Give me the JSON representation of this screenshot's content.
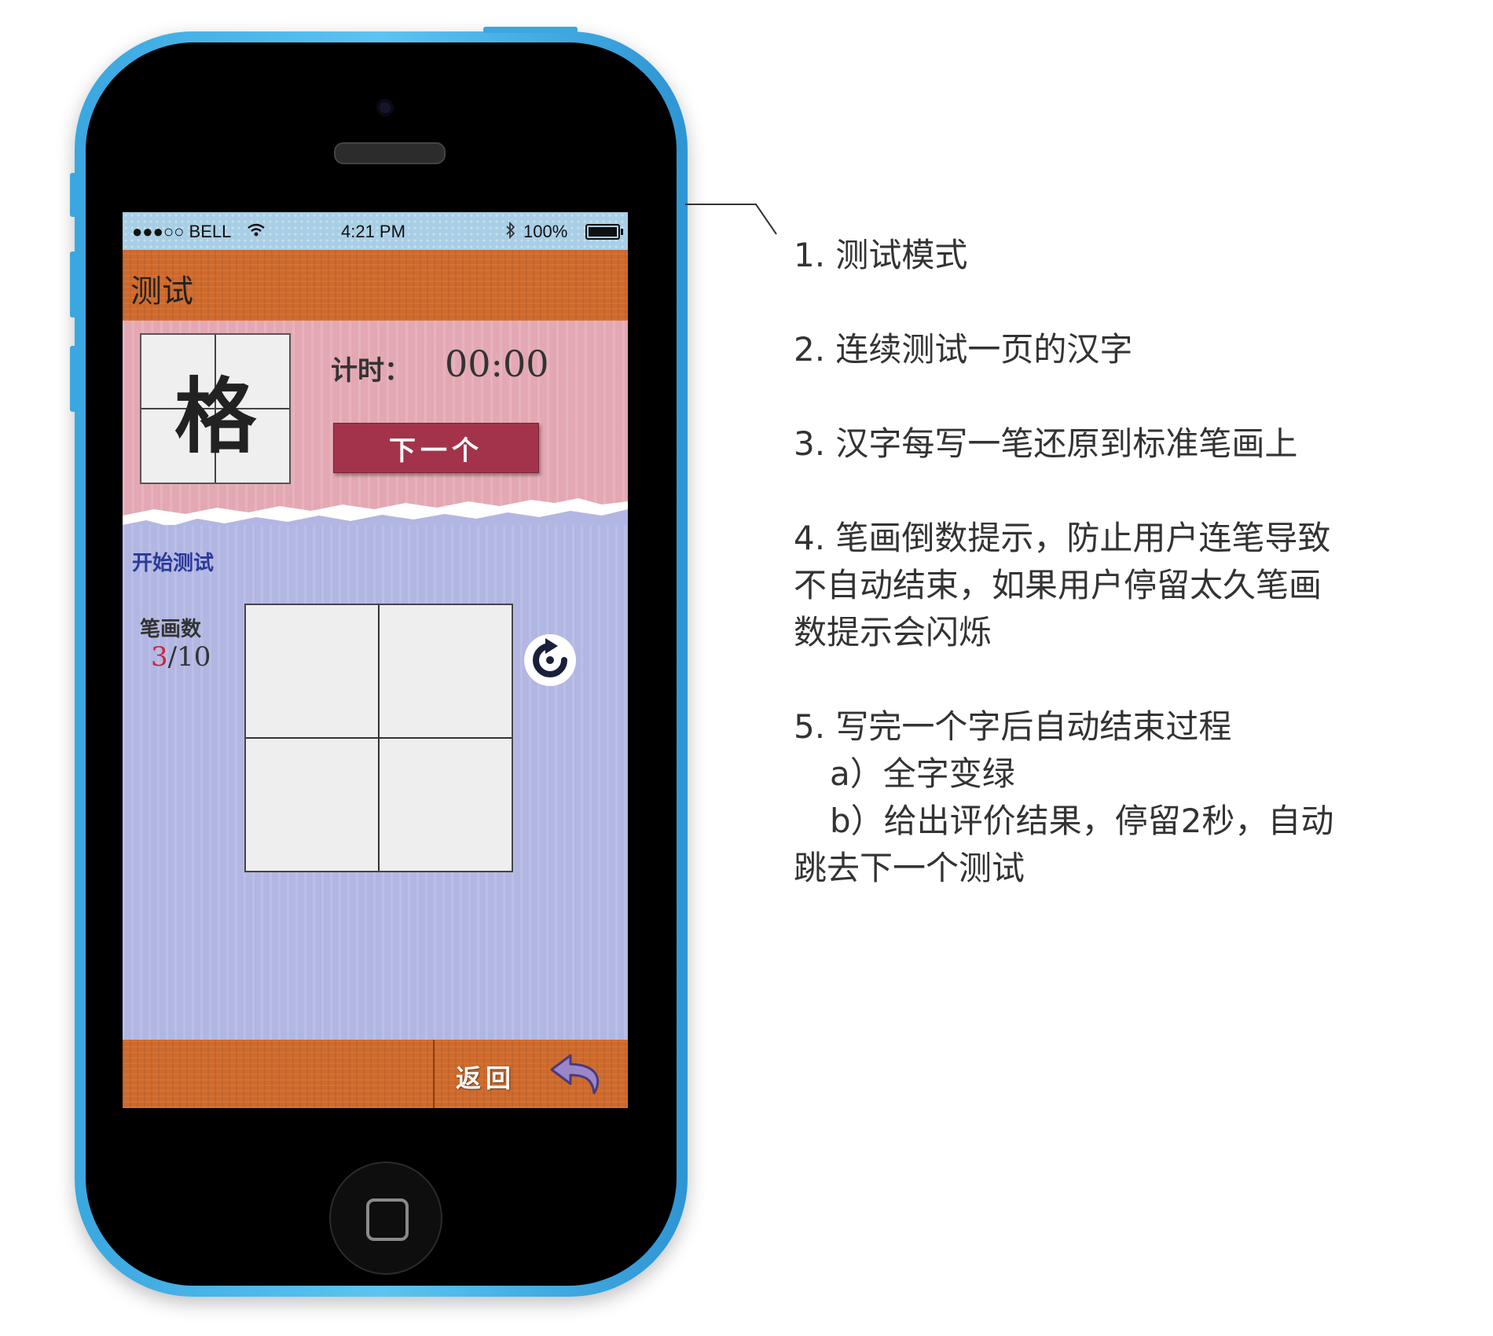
{
  "status_bar": {
    "carrier": "●●●○○ BELL",
    "time": "4:21 PM",
    "battery": "100%"
  },
  "header": {
    "title": "测试"
  },
  "character_panel": {
    "character": "格",
    "timer_label": "计时：",
    "timer_value": "00:00",
    "next_button": "下一个"
  },
  "test_panel": {
    "start_link": "开始测试",
    "strokes_label": "笔画数",
    "strokes_current": "3",
    "strokes_total": "/10",
    "reset_icon": "refresh-icon"
  },
  "footer": {
    "back_label": "返回",
    "back_icon": "back-arrow-icon"
  },
  "annotations": {
    "note1": "1. 测试模式",
    "note2": "2. 连续测试一页的汉字",
    "note3": "3. 汉字每写一笔还原到标准笔画上",
    "note4_lines": [
      "4. 笔画倒数提示，防止用户连笔导致",
      "不自动结束，如果用户停留太久笔画",
      "数提示会闪烁"
    ],
    "note5_lines": [
      "5. 写完一个字后自动结束过程",
      "a）全字变绿",
      "b）给出评价结果，停留2秒，自动",
      "跳去下一个测试"
    ]
  },
  "colors": {
    "phone_shell": "#3aa7e0",
    "bar_orange": "#cf6a2c",
    "panel_pink": "#e3a8b3",
    "panel_lavender": "#b2b6e2",
    "next_button": "#a3334a",
    "stroke_highlight": "#c8283a"
  }
}
